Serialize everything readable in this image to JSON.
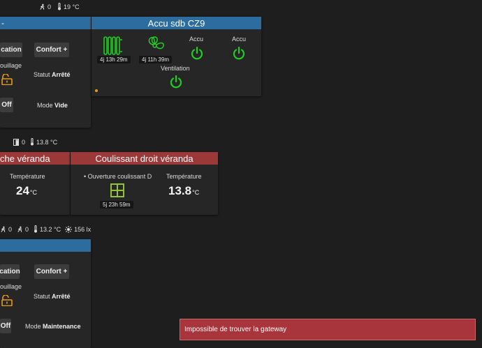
{
  "status_bars": {
    "top": {
      "motion": "0",
      "temp": "19 °C"
    },
    "middle": {
      "door": "0",
      "temp": "13.8 °C"
    },
    "lower": {
      "motion_a": "0",
      "motion_b": "0",
      "temp": "13.2 °C",
      "lux": "156 lx"
    }
  },
  "heater_card_top": {
    "btn_left": "cation",
    "btn_confort": "Confort +",
    "lock_label": "ouillage",
    "statut_label": "Statut",
    "statut_value": "Arrêté",
    "off_label": "Off",
    "mode_label": "Mode",
    "mode_value": "Vide"
  },
  "accu_card": {
    "title": "Accu sdb CZ9",
    "radiator_time": "4j 13h 29m",
    "fan_time": "4j 11h 39m",
    "accu1_label": "Accu",
    "accu2_label": "Accu",
    "ventilation_label": "Ventilation"
  },
  "veranda_left_card": {
    "title": "che véranda",
    "temp_label": "Température",
    "temp_value": "24",
    "temp_unit": "°C"
  },
  "veranda_right_card": {
    "title": "Coulissant droit véranda",
    "opening_label": "• Ouverture coulissant D",
    "opening_time": "5j 23h 59m",
    "temp_label": "Température",
    "temp_value": "13.8",
    "temp_unit": "°C"
  },
  "heater_card_bottom": {
    "btn_left": "cation",
    "btn_confort": "Confort +",
    "lock_label": "ouillage",
    "statut_label": "Statut",
    "statut_value": "Arrêté",
    "off_label": "Off",
    "mode_label": "Mode",
    "mode_value": "Maintenance"
  },
  "toast": {
    "message": "Impossible de trouver la gateway"
  },
  "colors": {
    "card_header_blue": "#2d6c9f",
    "card_header_red": "#9b3838",
    "icon_green": "#22cc22",
    "icon_olive": "#8fc33a",
    "lock_orange": "#e89a1e",
    "toast_bg": "#a8353c"
  }
}
